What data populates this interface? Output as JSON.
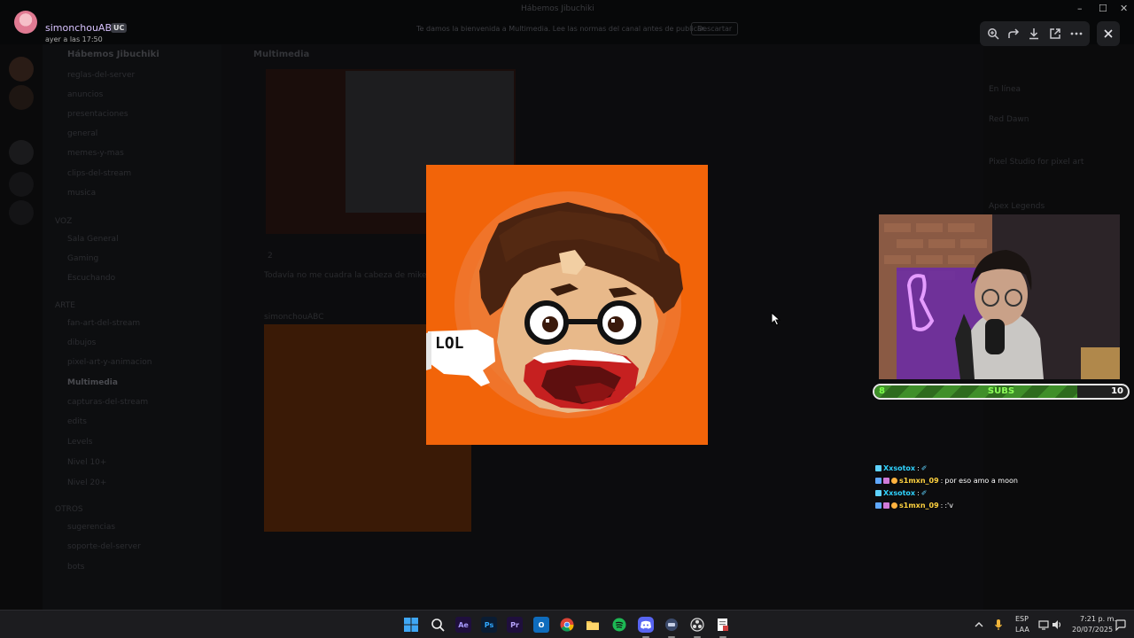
{
  "window": {
    "title": "Hábemos Jibuchiki",
    "minimize_glyph": "–",
    "maximize_glyph": "☐",
    "close_glyph": "✕"
  },
  "viewer": {
    "author": "simonchouABC",
    "badge": "UC",
    "timestamp": "ayer a las 17:50",
    "banner_text": "Te damos la bienvenida a Multimedia. Lee las normas del canal antes de publicar.",
    "banner_button": "Descartar",
    "toolbar_icons": [
      "zoom-icon",
      "forward-icon",
      "download-icon",
      "open-external-icon",
      "more-icon"
    ],
    "close_icon": "close-icon"
  },
  "discord_bg": {
    "server_name": "Hábemos Jibuchiki",
    "channels": [
      "reglas-del-server",
      "anuncios",
      "presentaciones",
      "general",
      "memes-y-mas",
      "clips-del-stream",
      "musica",
      "VOZ",
      "Sala General",
      "Gaming",
      "Escuchando",
      "ARTE",
      "fan-art-del-stream",
      "dibujos",
      "pixel-art-y-animacion",
      "Multimedia",
      "capturas-del-stream",
      "edits",
      "Levels",
      "Nivel 10+",
      "Nivel 20+",
      "OTROS",
      "sugerencias",
      "soporte-del-server",
      "bots"
    ],
    "active_channel": "Multimedia",
    "chat_header": "Multimedia",
    "reaction_count": "2",
    "message_text": "Todavía no me cuadra la cabeza de mike",
    "second_author": "simonchouABC",
    "right_items": [
      "En línea",
      "Red Dawn",
      "Pixel Studio for pixel art",
      "Apex Legends"
    ]
  },
  "stream_overlay": {
    "sub_goal": {
      "current": 8,
      "goal": 10,
      "label": "SUBS",
      "progress": 0.8
    },
    "chat": [
      {
        "user": "Xxsotox",
        "text": "✐",
        "user_color": "#2fd3ff"
      },
      {
        "user": "s1mxn_09",
        "text": "por eso amo a moon",
        "user_color": "#ffd23f"
      },
      {
        "user": "Xxsotox",
        "text": "✐",
        "user_color": "#2fd3ff"
      },
      {
        "user": "s1mxn_09",
        "text": ":'v",
        "user_color": "#ffd23f"
      }
    ]
  },
  "preview": {
    "speech_bubble": "LOL",
    "bg_color": "#f26409"
  },
  "taskbar": {
    "apps": [
      {
        "name": "windows-start-icon"
      },
      {
        "name": "search-icon"
      },
      {
        "name": "after-effects-icon",
        "label": "Ae"
      },
      {
        "name": "photoshop-icon",
        "label": "Ps"
      },
      {
        "name": "premiere-icon",
        "label": "Pr"
      },
      {
        "name": "outlook-icon",
        "label": "O"
      },
      {
        "name": "chrome-icon"
      },
      {
        "name": "file-explorer-icon"
      },
      {
        "name": "spotify-icon"
      },
      {
        "name": "discord-icon"
      },
      {
        "name": "app-icon"
      },
      {
        "name": "obs-icon"
      },
      {
        "name": "notepad-icon"
      }
    ],
    "lang_top": "ESP",
    "lang_bottom": "LAA",
    "clock_time": "7:21 p. m.",
    "clock_date": "20/07/2025"
  }
}
